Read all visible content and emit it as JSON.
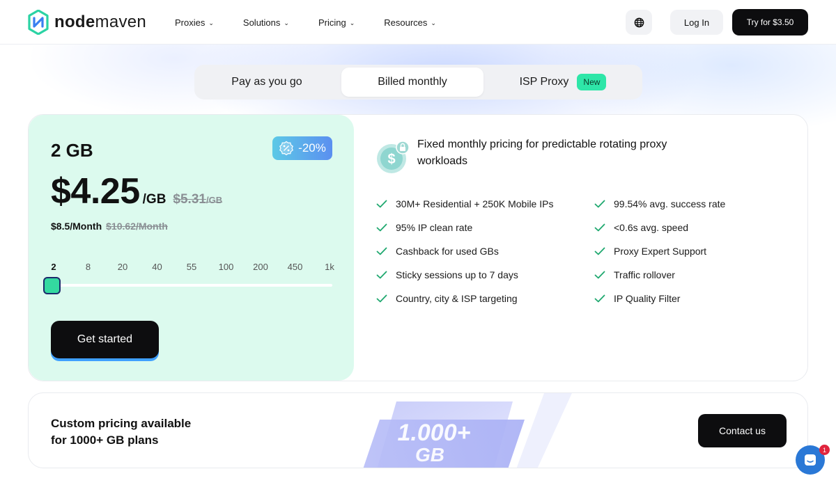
{
  "header": {
    "logo_text_bold": "node",
    "logo_text_light": "maven",
    "nav": [
      {
        "label": "Proxies"
      },
      {
        "label": "Solutions"
      },
      {
        "label": "Pricing"
      },
      {
        "label": "Resources"
      }
    ],
    "login_label": "Log In",
    "try_label": "Try for $3.50"
  },
  "tabs": {
    "payg": "Pay as you go",
    "monthly": "Billed monthly",
    "isp": "ISP Proxy",
    "isp_badge": "New",
    "active": "monthly"
  },
  "plan": {
    "size": "2 GB",
    "discount": "-20%",
    "price": "$4.25",
    "per_unit": "/GB",
    "old_price": "$5.31",
    "old_per_unit": "/GB",
    "monthly": "$8.5/Month",
    "old_monthly": "$10.62/Month",
    "slider_steps": [
      "2",
      "8",
      "20",
      "40",
      "55",
      "100",
      "200",
      "450",
      "1k"
    ],
    "slider_selected": "2",
    "cta": "Get started"
  },
  "features": {
    "headline": "Fixed monthly pricing for predictable rotating proxy workloads",
    "left": [
      "30M+ Residential + 250K Mobile IPs",
      "95% IP clean rate",
      "Cashback for used GBs",
      "Sticky sessions up to 7 days",
      "Country, city & ISP targeting"
    ],
    "right": [
      "99.54% avg. success rate",
      "<0.6s avg. speed",
      "Proxy Expert Support",
      "Traffic rollover",
      "IP Quality Filter"
    ]
  },
  "custom": {
    "line1": "Custom pricing available",
    "line2": "for 1000+ GB plans",
    "graphic_line1": "1.000+",
    "graphic_line2": "GB",
    "contact_label": "Contact us"
  },
  "chat": {
    "unread": "1"
  },
  "colors": {
    "accent_green": "#2ee6a8",
    "panel_green": "#dcfaee",
    "dark": "#0d0d0f",
    "check": "#1fa86f"
  }
}
